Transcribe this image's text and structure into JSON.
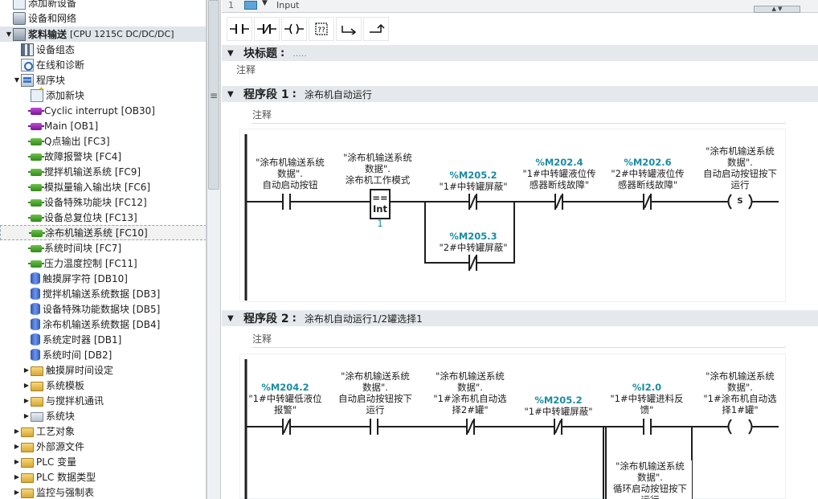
{
  "tree": {
    "items": [
      {
        "label": "添加新设备",
        "icon": "add-device-icon"
      },
      {
        "label": "设备和网络",
        "icon": "network-icon"
      },
      {
        "label": "浆料输送",
        "suffix": "[CPU 1215C DC/DC/DC]",
        "icon": "cpu-icon"
      },
      {
        "label": "设备组态",
        "icon": "device-config-icon"
      },
      {
        "label": "在线和诊断",
        "icon": "diagnostics-icon"
      },
      {
        "label": "程序块",
        "icon": "program-blocks-icon"
      },
      {
        "label": "添加新块",
        "icon": "add-block-icon"
      },
      {
        "label": "Cyclic interrupt [OB30]",
        "icon": "ob-icon"
      },
      {
        "label": "Main [OB1]",
        "icon": "ob-icon"
      },
      {
        "label": "Q点输出 [FC3]",
        "icon": "fc-icon"
      },
      {
        "label": "故障报警块 [FC4]",
        "icon": "fc-icon"
      },
      {
        "label": "搅拌机输送系统 [FC9]",
        "icon": "fc-icon"
      },
      {
        "label": "模拟量输入输出块 [FC6]",
        "icon": "fc-icon"
      },
      {
        "label": "设备特殊功能块 [FC12]",
        "icon": "fc-icon"
      },
      {
        "label": "设备总复位块 [FC13]",
        "icon": "fc-icon"
      },
      {
        "label": "涂布机输送系统 [FC10]",
        "icon": "fc-icon"
      },
      {
        "label": "系统时间块 [FC7]",
        "icon": "fc-icon"
      },
      {
        "label": "压力温度控制 [FC11]",
        "icon": "fc-icon"
      },
      {
        "label": "触摸屏字符 [DB10]",
        "icon": "db-icon"
      },
      {
        "label": "搅拌机输送系统数据 [DB3]",
        "icon": "db-icon"
      },
      {
        "label": "设备特殊功能数据块 [DB5]",
        "icon": "db-icon"
      },
      {
        "label": "涂布机输送系统数据 [DB4]",
        "icon": "db-icon"
      },
      {
        "label": "系统定时器 [DB1]",
        "icon": "db-icon"
      },
      {
        "label": "系统时间 [DB2]",
        "icon": "db-icon"
      },
      {
        "label": "触摸屏时间设定",
        "icon": "folder-icon"
      },
      {
        "label": "系统模板",
        "icon": "folder-icon"
      },
      {
        "label": "与搅拌机通讯",
        "icon": "folder-icon"
      },
      {
        "label": "系统块",
        "icon": "system-folder-icon"
      },
      {
        "label": "工艺对象",
        "icon": "folder-icon"
      },
      {
        "label": "外部源文件",
        "icon": "folder-icon"
      },
      {
        "label": "PLC 变量",
        "icon": "folder-icon"
      },
      {
        "label": "PLC 数据类型",
        "icon": "folder-icon"
      },
      {
        "label": "监控与强制表",
        "icon": "folder-icon"
      }
    ]
  },
  "interface": {
    "row_number": "1",
    "name": "Input"
  },
  "block": {
    "title_label": "块标题",
    "title_value": ".....",
    "comment": "注释"
  },
  "networks": [
    {
      "label": "程序段 1",
      "title": "涂布机自动运行",
      "comment": "注释",
      "ops": {
        "c1": "\"涂布机输送系统\n数据\".\n自动启动按钮",
        "cmp_label": "\"涂布机输送系统\n数据\".\n涂布机工作模式",
        "cmp_op": "==",
        "cmp_type": "Int",
        "cmp_value": "1",
        "c2_addr": "%M205.2",
        "c2_name": "\"1#中转罐屏蔽\"",
        "c3_addr": "%M205.3",
        "c3_name": "\"2#中转罐屏蔽\"",
        "c4_addr": "%M202.4",
        "c4_name": "\"1#中转罐液位传\n感器断线故障\"",
        "c5_addr": "%M202.6",
        "c5_name": "\"2#中转罐液位传\n感器断线故障\"",
        "coil_label": "\"涂布机输送系统\n数据\".\n自动启动按钮按下\n运行",
        "coil_symbol": "S"
      }
    },
    {
      "label": "程序段 2",
      "title": "涂布机自动运行1/2罐选择1",
      "comment": "注释",
      "ops": {
        "c1_addr": "%M204.2",
        "c1_name": "\"1#中转罐低液位\n报警\"",
        "c2": "\"涂布机输送系统\n数据\".\n自动启动按钮按下\n运行",
        "c3": "\"涂布机输送系统\n数据\".\n\"1#涂布机自动选\n择2#罐\"",
        "c4_addr": "%M205.2",
        "c4_name": "\"1#中转罐屏蔽\"",
        "c5_addr": "%I2.0",
        "c5_name": "\"1#中转罐进料反\n馈\"",
        "c6": "\"涂布机输送系统\n数据\".\n循环启动按钮按下\n运行",
        "coil_label": "\"涂布机输送系统\n数据\".\n\"1#涂布机自动选\n择1#罐\""
      }
    }
  ],
  "toolbar": {
    "icons": [
      "no-contact-icon",
      "nc-contact-icon",
      "coil-icon",
      "empty-box-icon",
      "open-branch-icon",
      "close-branch-icon"
    ]
  }
}
